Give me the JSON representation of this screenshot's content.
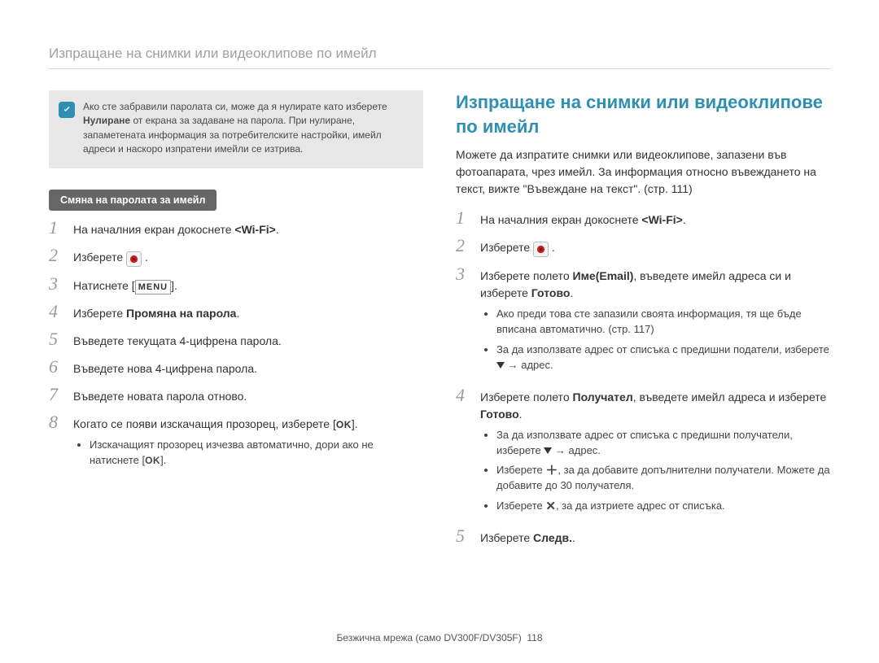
{
  "page_title": "Изпращане на снимки или видеоклипове по имейл",
  "note": {
    "line1": "Ако сте забравили паролата си, може да я нулирате като изберете ",
    "bold": "Нулиране",
    "line2": " от екрана за задаване на парола. При нулиране, запаметената информация за потребителските настройки, имейл адреси и наскоро изпратени имейли се изтрива."
  },
  "left": {
    "section_title": "Смяна на паролата за имейл",
    "steps": {
      "s1_a": "На началния екран докоснете ",
      "s1_b": "<Wi-Fi>",
      "s1_c": ".",
      "s2_a": "Изберете ",
      "s2_c": " .",
      "s3_a": "Натиснете [",
      "s3_menu": "MENU",
      "s3_b": "].",
      "s4_a": "Изберете ",
      "s4_bold": "Промяна на парола",
      "s4_b": ".",
      "s5": "Въведете текущата 4-цифрена парола.",
      "s6": "Въведете нова 4-цифрена парола.",
      "s7": "Въведете новата парола отново.",
      "s8_a": "Когато се появи изскачащия прозорец, изберете [",
      "s8_ok": "OK",
      "s8_b": "].",
      "s8_bullet_a": "Изскачащият прозорец изчезва автоматично, дори ако не натиснете [",
      "s8_bullet_ok": "OK",
      "s8_bullet_b": "]."
    }
  },
  "right": {
    "heading": "Изпращане на снимки или видеоклипове по имейл",
    "intro": "Можете да изпратите снимки или видеоклипове, запазени във фотоапарата, чрез имейл. За информация относно въвеждането на текст, вижте \"Въвеждане на текст\". (стр. 111)",
    "steps": {
      "s1_a": "На началния екран докоснете ",
      "s1_b": "<Wi-Fi>",
      "s1_c": ".",
      "s2_a": "Изберете ",
      "s2_c": " .",
      "s3_a": "Изберете полето ",
      "s3_bold": "Име(Email)",
      "s3_b": ", въведете имейл адреса си и изберете ",
      "s3_bold2": "Готово",
      "s3_c": ".",
      "s3_bullet1": "Ако преди това сте запазили своята информация, тя ще бъде вписана автоматично. (стр. 117)",
      "s3_bullet2_a": "За да използвате адрес от списъка с предишни податели, изберете ",
      "s3_bullet2_b": " → адрес.",
      "s4_a": "Изберете полето ",
      "s4_bold": "Получател",
      "s4_b": ", въведете имейл адреса и изберете ",
      "s4_bold2": "Готово",
      "s4_c": ".",
      "s4_bullet1_a": "За да използвате адрес от списъка с предишни получатели, изберете ",
      "s4_bullet1_b": " → адрес.",
      "s4_bullet2_a": "Изберете ",
      "s4_bullet2_b": ", за да добавите допълнителни получатели. Можете да добавите до 30 получателя.",
      "s4_bullet3_a": "Изберете ",
      "s4_bullet3_b": ", за да изтриете адрес от списъка.",
      "s5_a": "Изберете ",
      "s5_bold": "Следв.",
      "s5_b": "."
    }
  },
  "footer": {
    "label": "Безжична мрежа (само DV300F/DV305F)",
    "page": "118"
  }
}
